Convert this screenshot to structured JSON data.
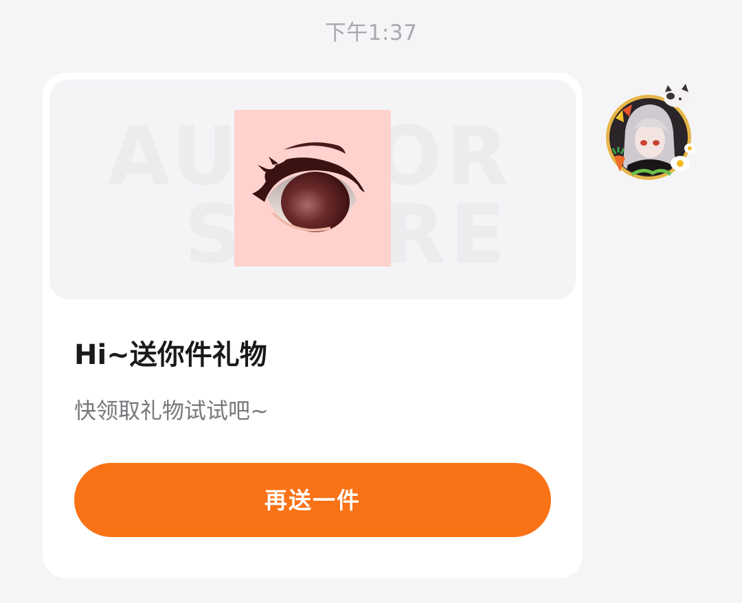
{
  "chat": {
    "timestamp": "下午1:37"
  },
  "gift_card": {
    "image_icon": "anime-eye-icon",
    "watermark_line1": "AUTHOR",
    "watermark_line2": "SCORE",
    "title": "Hi~送你件礼物",
    "subtitle": "快领取礼物试试吧~",
    "button_label": "再送一件"
  },
  "sender": {
    "avatar_icon": "anime-character-avatar"
  },
  "colors": {
    "background": "#f5f5f7",
    "card": "#ffffff",
    "accent": "#f97316",
    "item_background": "#ffd2cd",
    "timestamp_text": "#a9a9ad",
    "subtitle_text": "#77777c"
  }
}
